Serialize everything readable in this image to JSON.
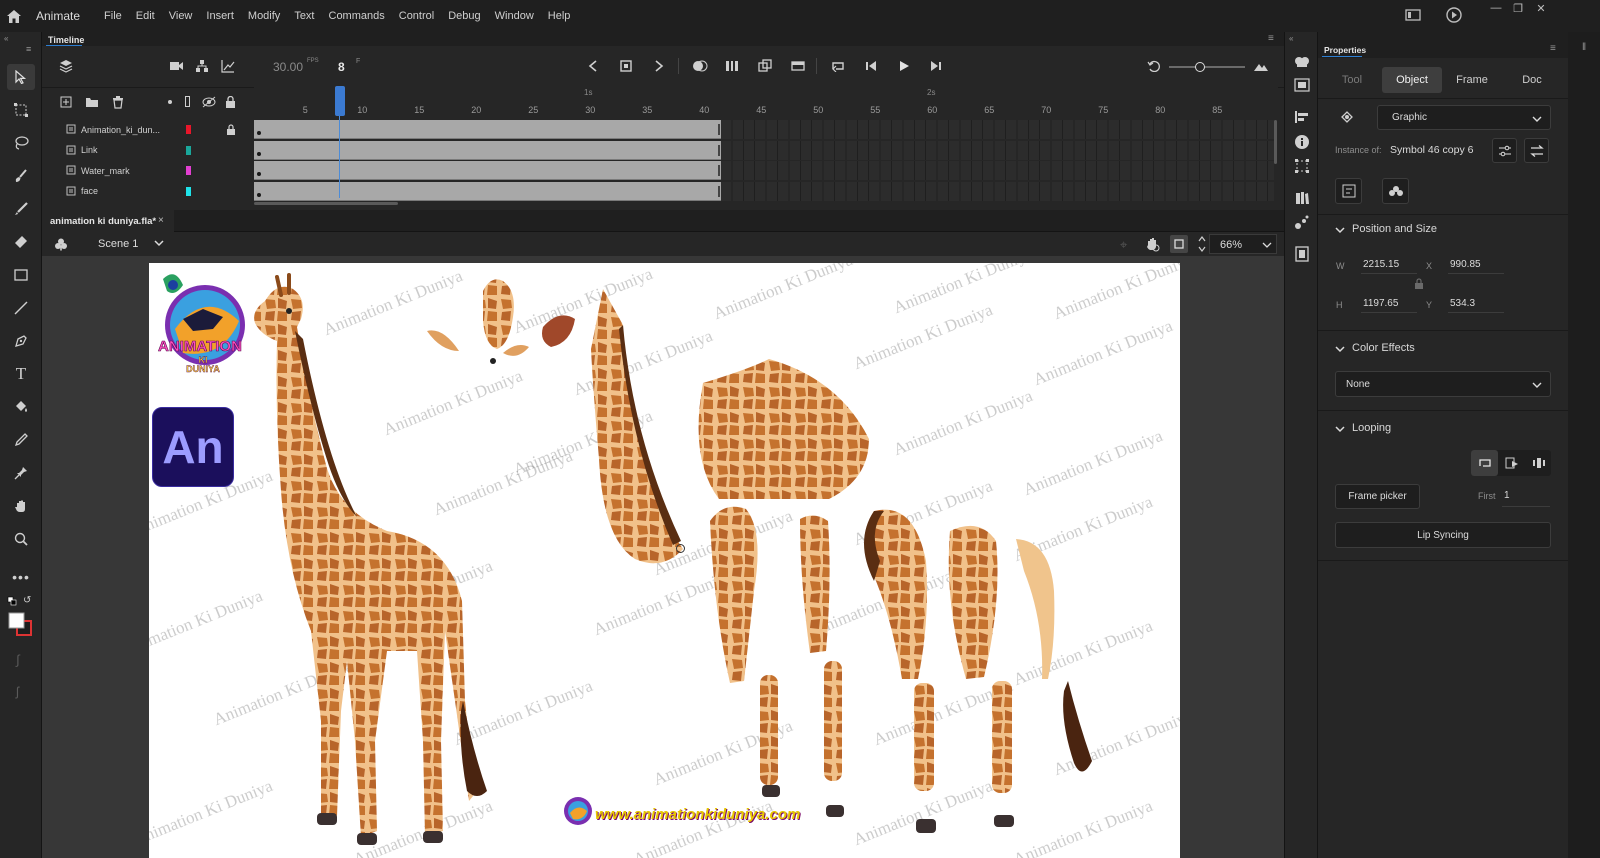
{
  "menubar": {
    "app_name": "Animate",
    "items": [
      "File",
      "Edit",
      "View",
      "Insert",
      "Modify",
      "Text",
      "Commands",
      "Control",
      "Debug",
      "Window",
      "Help"
    ]
  },
  "timeline": {
    "panel_title": "Timeline",
    "fps_value": "30.00",
    "fps_unit": "FPS",
    "current_frame": "8",
    "frame_unit": "F",
    "ruler_ticks": [
      "5",
      "10",
      "15",
      "20",
      "25",
      "30",
      "35",
      "40",
      "45",
      "50",
      "55",
      "60",
      "65",
      "70",
      "75",
      "80",
      "85"
    ],
    "ruler_seconds": [
      "1s",
      "2s"
    ],
    "layers": [
      {
        "name": "Animation_ki_dun...",
        "color": "#e8162a",
        "locked": true
      },
      {
        "name": "Link",
        "color": "#1aa79b",
        "locked": false
      },
      {
        "name": "Water_mark",
        "color": "#e23fd1",
        "locked": false
      },
      {
        "name": "face",
        "color": "#1fe3ea",
        "locked": false
      }
    ],
    "playhead_frame": 8,
    "last_keyframe": 41
  },
  "document": {
    "tab_name": "animation ki duniya.fla*",
    "close_glyph": "×",
    "scene_name": "Scene 1",
    "zoom": "66%"
  },
  "stage": {
    "watermark_text": "Animation Ki Duniya",
    "logo_text": "ANIMATION KI DUNIYA",
    "an_badge": "An",
    "website": "www.animationkiduniya.com"
  },
  "properties": {
    "panel_title": "Properties",
    "tabs": [
      "Tool",
      "Object",
      "Frame",
      "Doc"
    ],
    "active_tab": "Object",
    "symbol_type": "Graphic",
    "instance_of_label": "Instance of:",
    "instance_of_value": "Symbol 46 copy 6",
    "position_size_heading": "Position and Size",
    "w_label": "W",
    "w_value": "2215.15",
    "x_label": "X",
    "x_value": "990.85",
    "h_label": "H",
    "h_value": "1197.65",
    "y_label": "Y",
    "y_value": "534.3",
    "color_effects_heading": "Color Effects",
    "color_effect_value": "None",
    "looping_heading": "Looping",
    "frame_picker_label": "Frame picker",
    "first_label": "First",
    "first_value": "1",
    "lip_syncing_label": "Lip Syncing"
  },
  "colors": {
    "accent_blue": "#2d7fd3",
    "playhead": "#4c8bd6",
    "an_badge_bg": "#1b0f5c",
    "an_badge_text": "#9c9cff"
  }
}
